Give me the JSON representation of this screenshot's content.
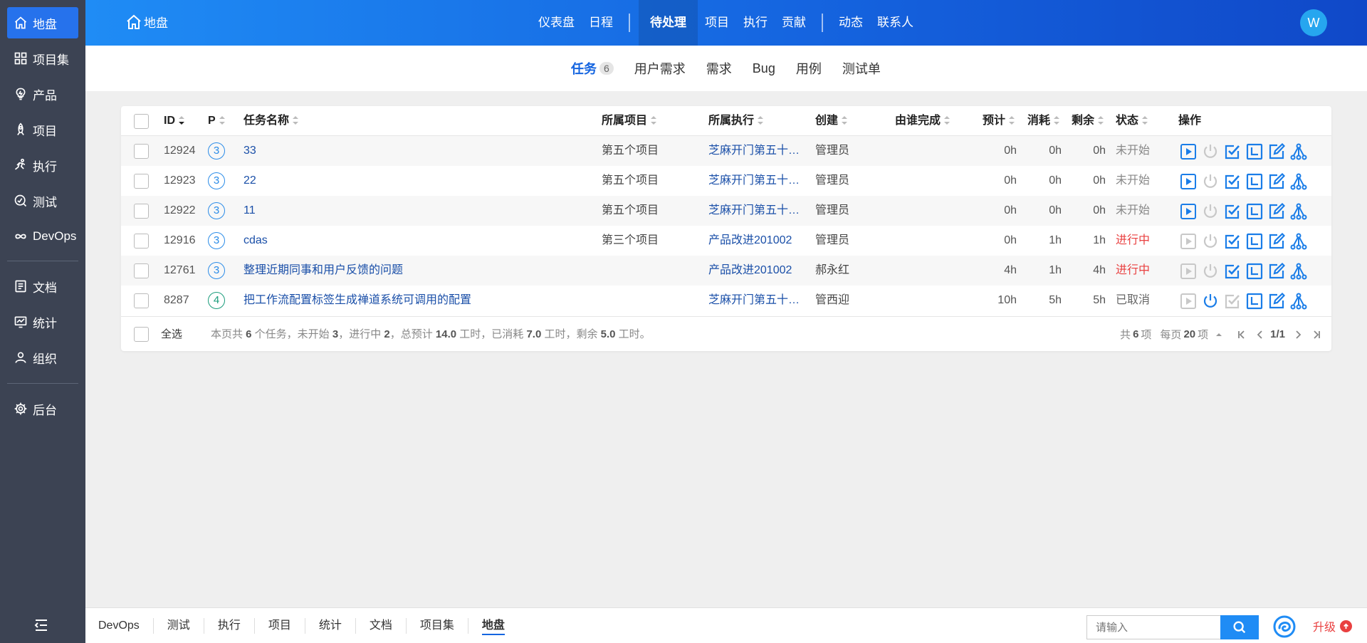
{
  "sidebar": {
    "items": [
      {
        "label": "地盘",
        "icon": "home-icon"
      },
      {
        "label": "项目集",
        "icon": "grid-icon"
      },
      {
        "label": "产品",
        "icon": "lightbulb-icon"
      },
      {
        "label": "项目",
        "icon": "rocket-icon"
      },
      {
        "label": "执行",
        "icon": "running-icon"
      },
      {
        "label": "测试",
        "icon": "test-icon"
      },
      {
        "label": "DevOps",
        "icon": "infinity-icon"
      },
      {
        "label": "文档",
        "icon": "document-icon"
      },
      {
        "label": "统计",
        "icon": "chart-icon"
      },
      {
        "label": "组织",
        "icon": "user-icon"
      },
      {
        "label": "后台",
        "icon": "gear-icon"
      }
    ]
  },
  "header": {
    "home_label": "地盘",
    "nav": [
      "仪表盘",
      "日程",
      "待处理",
      "项目",
      "执行",
      "贡献",
      "动态",
      "联系人"
    ],
    "avatar": "W"
  },
  "subnav": {
    "tabs": [
      "任务",
      "用户需求",
      "需求",
      "Bug",
      "用例",
      "测试单"
    ],
    "task_count": "6"
  },
  "table": {
    "columns": [
      "ID",
      "P",
      "任务名称",
      "所属项目",
      "所属执行",
      "创建",
      "由谁完成",
      "预计",
      "消耗",
      "剩余",
      "状态",
      "操作"
    ],
    "rows": [
      {
        "id": "12924",
        "p": "3",
        "name": "33",
        "project": "第五个项目",
        "execution": "芝麻开门第五十…",
        "creator": "管理员",
        "finisher": "",
        "estimate": "0h",
        "consumed": "0h",
        "left": "0h",
        "status": "未开始",
        "status_type": "wait"
      },
      {
        "id": "12923",
        "p": "3",
        "name": "22",
        "project": "第五个项目",
        "execution": "芝麻开门第五十…",
        "creator": "管理员",
        "finisher": "",
        "estimate": "0h",
        "consumed": "0h",
        "left": "0h",
        "status": "未开始",
        "status_type": "wait"
      },
      {
        "id": "12922",
        "p": "3",
        "name": "11",
        "project": "第五个项目",
        "execution": "芝麻开门第五十…",
        "creator": "管理员",
        "finisher": "",
        "estimate": "0h",
        "consumed": "0h",
        "left": "0h",
        "status": "未开始",
        "status_type": "wait"
      },
      {
        "id": "12916",
        "p": "3",
        "name": "cdas",
        "project": "第三个项目",
        "execution": "产品改进201002",
        "creator": "管理员",
        "finisher": "",
        "estimate": "0h",
        "consumed": "1h",
        "left": "1h",
        "status": "进行中",
        "status_type": "doing"
      },
      {
        "id": "12761",
        "p": "3",
        "name": "整理近期同事和用户反馈的问题",
        "project": "",
        "execution": "产品改进201002",
        "creator": "郝永红",
        "finisher": "",
        "estimate": "4h",
        "consumed": "1h",
        "left": "4h",
        "status": "进行中",
        "status_type": "doing"
      },
      {
        "id": "8287",
        "p": "4",
        "name": "把工作流配置标签生成禅道系统可调用的配置",
        "project": "",
        "execution": "芝麻开门第五十…",
        "creator": "管西迎",
        "finisher": "",
        "estimate": "10h",
        "consumed": "5h",
        "left": "5h",
        "status": "已取消",
        "status_type": "cancel"
      }
    ],
    "select_all": "全选",
    "summary": {
      "p1": "本页共 ",
      "total": "6",
      "p2": " 个任务，未开始 ",
      "wait": "3",
      "p3": "，进行中 ",
      "doing": "2",
      "p4": "，总预计 ",
      "estimate": "14.0",
      "p5": " 工时，已消耗 ",
      "consumed": "7.0",
      "p6": " 工时，剩余 ",
      "left": "5.0",
      "p7": " 工时。"
    },
    "pager": {
      "p1": "共",
      "total": "6",
      "p2": "项",
      "p3": "每页",
      "per_page": "20",
      "p4": "项",
      "page": "1/1"
    }
  },
  "bottombar": {
    "tabs": [
      "DevOps",
      "测试",
      "执行",
      "项目",
      "统计",
      "文档",
      "项目集",
      "地盘"
    ],
    "search_placeholder": "请输入",
    "upgrade": "升级"
  },
  "colors": {
    "accent": "#1565e0",
    "sidebar": "#3c4353",
    "doing": "#e94040"
  }
}
